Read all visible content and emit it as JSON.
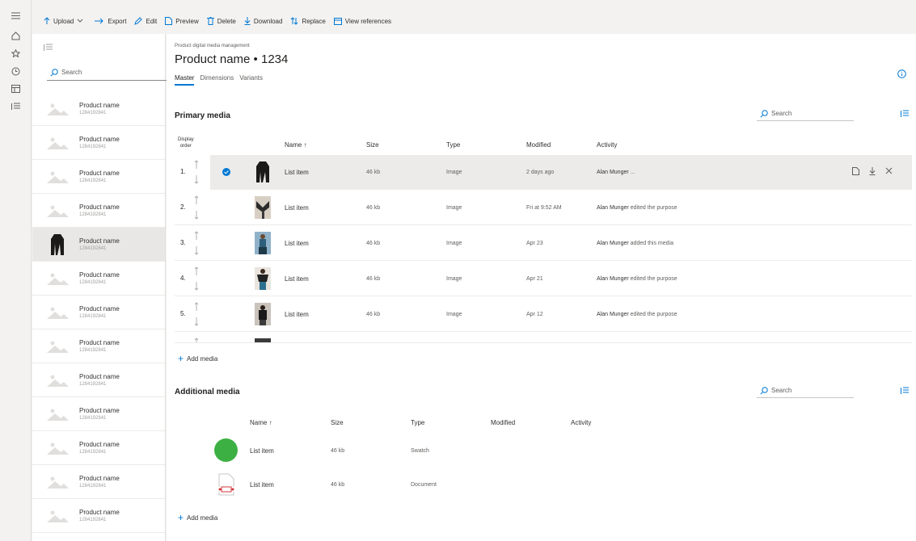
{
  "commands": [
    {
      "label": "Upload",
      "icon": "upload-icon"
    },
    {
      "label": "Export",
      "icon": "export-icon"
    },
    {
      "label": "Edit",
      "icon": "edit-icon"
    },
    {
      "label": "Preview",
      "icon": "preview-icon"
    },
    {
      "label": "Delete",
      "icon": "delete-icon"
    },
    {
      "label": "Download",
      "icon": "download-icon"
    },
    {
      "label": "Replace",
      "icon": "replace-icon"
    },
    {
      "label": "View references",
      "icon": "references-icon"
    }
  ],
  "list": {
    "search_placeholder": "Search",
    "items": [
      {
        "name": "Product name",
        "id": "1284192841"
      },
      {
        "name": "Product name",
        "id": "1284192841"
      },
      {
        "name": "Product name",
        "id": "1284192841"
      },
      {
        "name": "Product name",
        "id": "1284192841"
      },
      {
        "name": "Product name",
        "id": "1284192841"
      },
      {
        "name": "Product name",
        "id": "1284192841"
      },
      {
        "name": "Product name",
        "id": "1284192841"
      },
      {
        "name": "Product name",
        "id": "1284192841"
      },
      {
        "name": "Product name",
        "id": "1284192841"
      },
      {
        "name": "Product name",
        "id": "1284192841"
      },
      {
        "name": "Product name",
        "id": "1284192841"
      },
      {
        "name": "Product name",
        "id": "1284192841"
      },
      {
        "name": "Product name",
        "id": "1284192841"
      }
    ]
  },
  "main": {
    "breadcrumb": "Product digital media management",
    "title": "Product name • 1234",
    "tabs": [
      "Master",
      "Dimensions",
      "Variants"
    ]
  },
  "primary": {
    "title": "Primary media",
    "search_placeholder": "Search",
    "headers": {
      "order_line1": "Display",
      "order_line2": "order",
      "name": "Name ↑",
      "size": "Size",
      "type": "Type",
      "modified": "Modified",
      "activity": "Activity"
    },
    "rows": [
      {
        "order": "1.",
        "name": "List item",
        "size": "46 kb",
        "type": "Image",
        "modified": "2 days ago",
        "user": "Alan Munger",
        "action": "..."
      },
      {
        "order": "2.",
        "name": "List item",
        "size": "46 kb",
        "type": "Image",
        "modified": "Fri at 9:52 AM",
        "user": "Alan Munger",
        "action": "edited the purpose"
      },
      {
        "order": "3.",
        "name": "List item",
        "size": "46 kb",
        "type": "Image",
        "modified": "Apr 23",
        "user": "Alan Munger",
        "action": "added this media"
      },
      {
        "order": "4.",
        "name": "List item",
        "size": "46 kb",
        "type": "Image",
        "modified": "Apr 21",
        "user": "Alan Munger",
        "action": "edited the purpose"
      },
      {
        "order": "5.",
        "name": "List item",
        "size": "46 kb",
        "type": "Image",
        "modified": "Apr 12",
        "user": "Alan Munger",
        "action": "edited the purpose"
      }
    ],
    "add_label": "Add media"
  },
  "additional": {
    "title": "Additional media",
    "search_placeholder": "Search",
    "headers": {
      "name": "Name ↑",
      "size": "Size",
      "type": "Type",
      "modified": "Modified",
      "activity": "Activity"
    },
    "rows": [
      {
        "name": "List item",
        "size": "46 kb",
        "type": "Swatch"
      },
      {
        "name": "List item",
        "size": "46 kb",
        "type": "Document"
      }
    ],
    "add_label": "Add media"
  },
  "colors": {
    "accent": "#0078d4",
    "swatch": "#3cb043",
    "doc": "#d13438"
  }
}
